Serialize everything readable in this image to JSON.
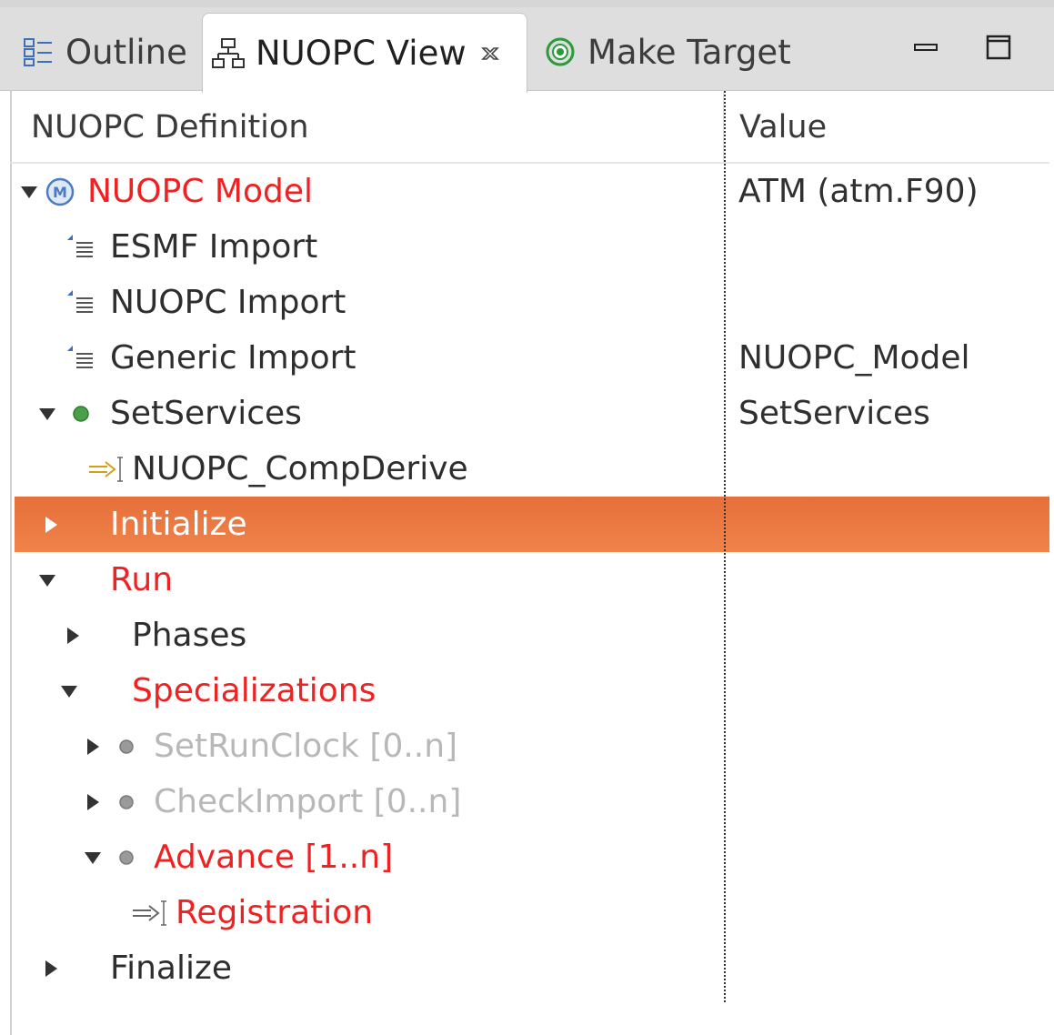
{
  "tabs": {
    "outline": "Outline",
    "nuopc_view": "NUOPC View",
    "make_target": "Make Target"
  },
  "columns": {
    "definition": "NUOPC Definition",
    "value": "Value"
  },
  "tree": {
    "model": {
      "label": "NUOPC Model",
      "value": "ATM (atm.F90)"
    },
    "esmf_import": {
      "label": "ESMF Import",
      "value": ""
    },
    "nuopc_import": {
      "label": "NUOPC Import",
      "value": ""
    },
    "generic_import": {
      "label": "Generic Import",
      "value": "NUOPC_Model"
    },
    "setservices": {
      "label": "SetServices",
      "value": "SetServices"
    },
    "compderive": {
      "label": "NUOPC_CompDerive"
    },
    "initialize": {
      "label": "Initialize"
    },
    "run": {
      "label": "Run"
    },
    "phases": {
      "label": "Phases"
    },
    "specializations": {
      "label": "Specializations"
    },
    "setrunclock": {
      "label": "SetRunClock [0..n]"
    },
    "checkimport": {
      "label": "CheckImport [0..n]"
    },
    "advance": {
      "label": "Advance [1..n]"
    },
    "registration": {
      "label": "Registration"
    },
    "finalize": {
      "label": "Finalize"
    }
  },
  "colors": {
    "selection": "#e9773f",
    "required": "#ee2222",
    "optional": "#b8b8b8"
  }
}
